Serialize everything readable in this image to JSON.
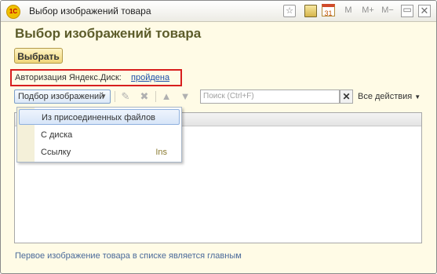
{
  "window": {
    "title": "Выбор изображений товара",
    "app_icon": "1c-logo-icon",
    "title_buttons": {
      "m": "M",
      "m_plus": "M+",
      "m_minus": "M−",
      "minimize": "▭",
      "close": "✕"
    }
  },
  "form": {
    "heading": "Выбор изображений товара",
    "select_button": "Выбрать",
    "auth_label": "Авторизация Яндекс.Диск:",
    "auth_status": "пройдена"
  },
  "toolbar": {
    "dropdown_label": "Подбор изображений",
    "search_placeholder": "Поиск (Ctrl+F)",
    "all_actions": "Все действия"
  },
  "menu": {
    "items": [
      {
        "label": "Из присоединенных файлов",
        "shortcut": "",
        "selected": true
      },
      {
        "label": "С диска",
        "shortcut": "",
        "selected": false
      },
      {
        "label": "Ссылку",
        "shortcut": "Ins",
        "selected": false
      }
    ]
  },
  "footer": {
    "note": "Первое изображение товара в списке является главным"
  },
  "colors": {
    "highlight_border": "#d81e1e",
    "link": "#1d4fa8",
    "form_bg": "#fffbe6"
  }
}
